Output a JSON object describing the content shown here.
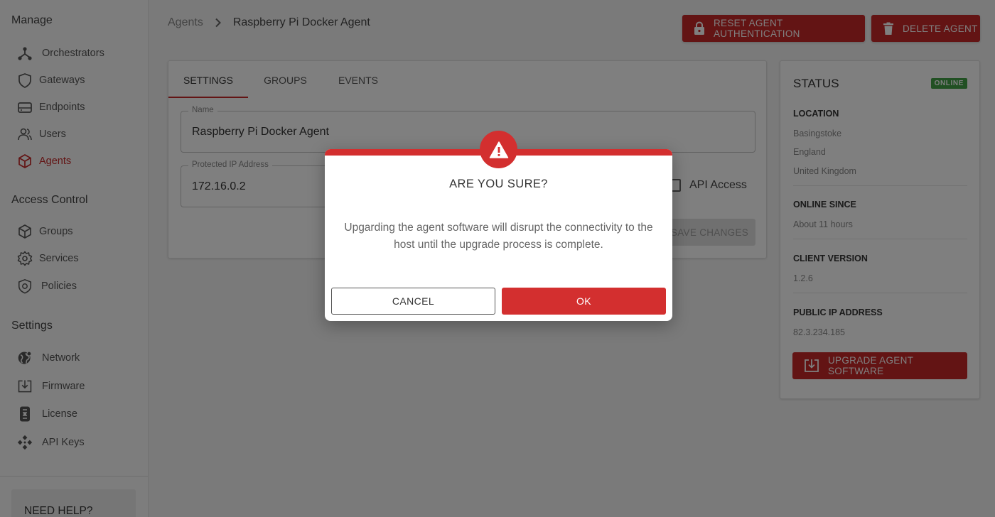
{
  "sidebar": {
    "sections": [
      {
        "title": "Manage"
      },
      {
        "title": "Access Control"
      },
      {
        "title": "Settings"
      }
    ],
    "items": [
      {
        "label": "Orchestrators",
        "icon": "orchestrator-icon"
      },
      {
        "label": "Gateways",
        "icon": "shield-icon"
      },
      {
        "label": "Endpoints",
        "icon": "endpoint-icon"
      },
      {
        "label": "Users",
        "icon": "users-icon"
      },
      {
        "label": "Agents",
        "icon": "cube-icon",
        "active": true
      },
      {
        "label": "Groups",
        "icon": "box-icon"
      },
      {
        "label": "Services",
        "icon": "gear-icon"
      },
      {
        "label": "Policies",
        "icon": "policy-shield-icon"
      },
      {
        "label": "Network",
        "icon": "globe-icon"
      },
      {
        "label": "Firmware",
        "icon": "download-box-icon"
      },
      {
        "label": "License",
        "icon": "license-icon"
      },
      {
        "label": "API Keys",
        "icon": "api-keys-icon"
      }
    ],
    "help_title": "NEED HELP?"
  },
  "breadcrumb": {
    "parent": "Agents",
    "current": "Raspberry Pi Docker Agent"
  },
  "header_buttons": {
    "reset_label": "RESET AGENT AUTHENTICATION",
    "delete_label": "DELETE AGENT"
  },
  "settings": {
    "tabs": [
      {
        "label": "SETTINGS",
        "active": true
      },
      {
        "label": "GROUPS"
      },
      {
        "label": "EVENTS"
      }
    ],
    "name_label": "Name",
    "name_value": "Raspberry Pi Docker Agent",
    "ip_label": "Protected IP Address",
    "ip_value": "172.16.0.2",
    "api_access_label": "API Access",
    "api_access_checked": false,
    "save_label": "SAVE CHANGES"
  },
  "status": {
    "title": "STATUS",
    "badge": "ONLINE",
    "location_label": "LOCATION",
    "location_lines": [
      "Basingstoke",
      "England",
      "United Kingdom"
    ],
    "online_since_label": "ONLINE SINCE",
    "online_since_value": "About 11 hours",
    "client_version_label": "CLIENT VERSION",
    "client_version_value": "1.2.6",
    "public_ip_label": "PUBLIC IP ADDRESS",
    "public_ip_value": "82.3.234.185",
    "upgrade_label": "UPGRADE AGENT SOFTWARE"
  },
  "modal": {
    "title": "ARE YOU SURE?",
    "body": "Upgarding the agent software will disrupt the connectivity to the host until the upgrade process is complete.",
    "cancel_label": "CANCEL",
    "ok_label": "OK"
  },
  "colors": {
    "accent_red": "#c62828",
    "online_green": "#43a047"
  }
}
